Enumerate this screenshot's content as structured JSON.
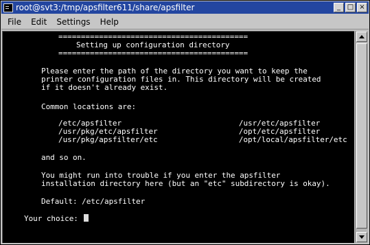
{
  "window": {
    "title": "root@svt3:/tmp/apsfilter611/share/apsfilter",
    "buttons": {
      "minimize": "_",
      "maximize": "□",
      "close": "×"
    }
  },
  "menubar": {
    "items": [
      "File",
      "Edit",
      "Settings",
      "Help"
    ]
  },
  "terminal": {
    "lines": [
      "==========================================",
      "Setting up configuration directory",
      "==========================================",
      "Please enter the path of the directory you want to keep the",
      "printer configuration files in. This directory will be created",
      "if it doesn't already exist.",
      "Common locations are:",
      "/etc/apsfilter                          /usr/etc/apsfilter",
      "/usr/pkg/etc/apsfilter                  /opt/etc/apsfilter",
      "/usr/pkg/apsfilter/etc                  /opt/local/apsfilter/etc",
      "and so on.",
      "You might run into trouble if you enter the apsfilter",
      "installation directory here (but an \"etc\" subdirectory is okay).",
      "Default: /etc/apsfilter",
      "Your choice: "
    ]
  },
  "colors": {
    "titlebar_bg": "#2346a0",
    "terminal_bg": "#000000",
    "terminal_fg": "#ffffff",
    "chrome_bg": "#c6c6c6"
  },
  "icons": [
    "terminal-icon",
    "minimize-icon",
    "maximize-icon",
    "close-icon",
    "scroll-up-arrow-icon",
    "scroll-down-arrow-icon"
  ]
}
